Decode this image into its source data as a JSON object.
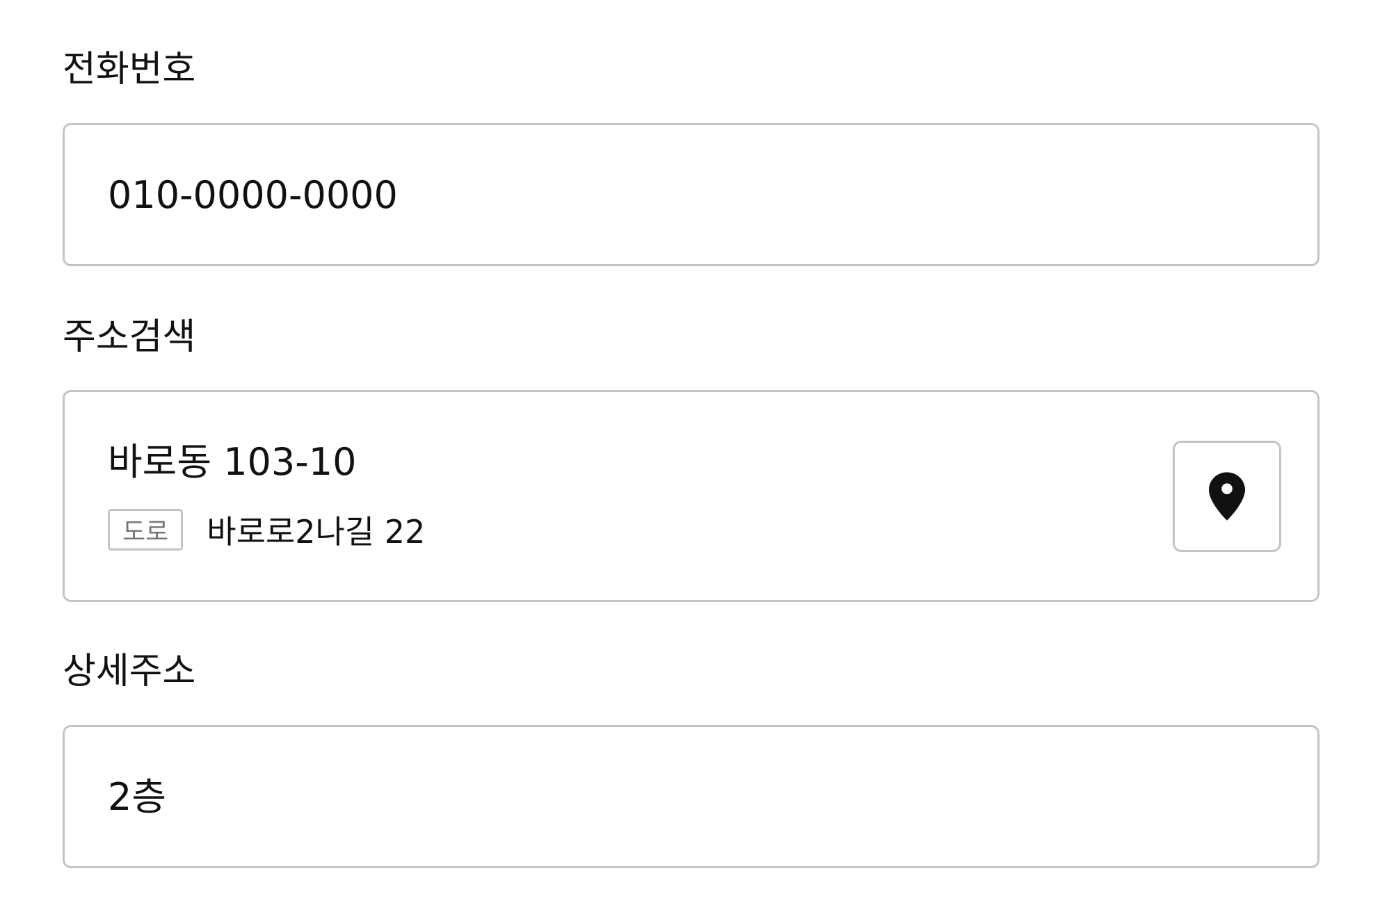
{
  "phone": {
    "label": "전화번호",
    "value": "010-0000-0000"
  },
  "address_search": {
    "label": "주소검색",
    "main_address": "바로동 103-10",
    "road_badge": "도로",
    "road_address": "바로로2나길 22",
    "button_icon": "map-pin-icon"
  },
  "detail_address": {
    "label": "상세주소",
    "value": "2층"
  },
  "colors": {
    "border": "#c4c4c4",
    "text": "#111111",
    "badge_text": "#777777",
    "icon": "#111111"
  }
}
